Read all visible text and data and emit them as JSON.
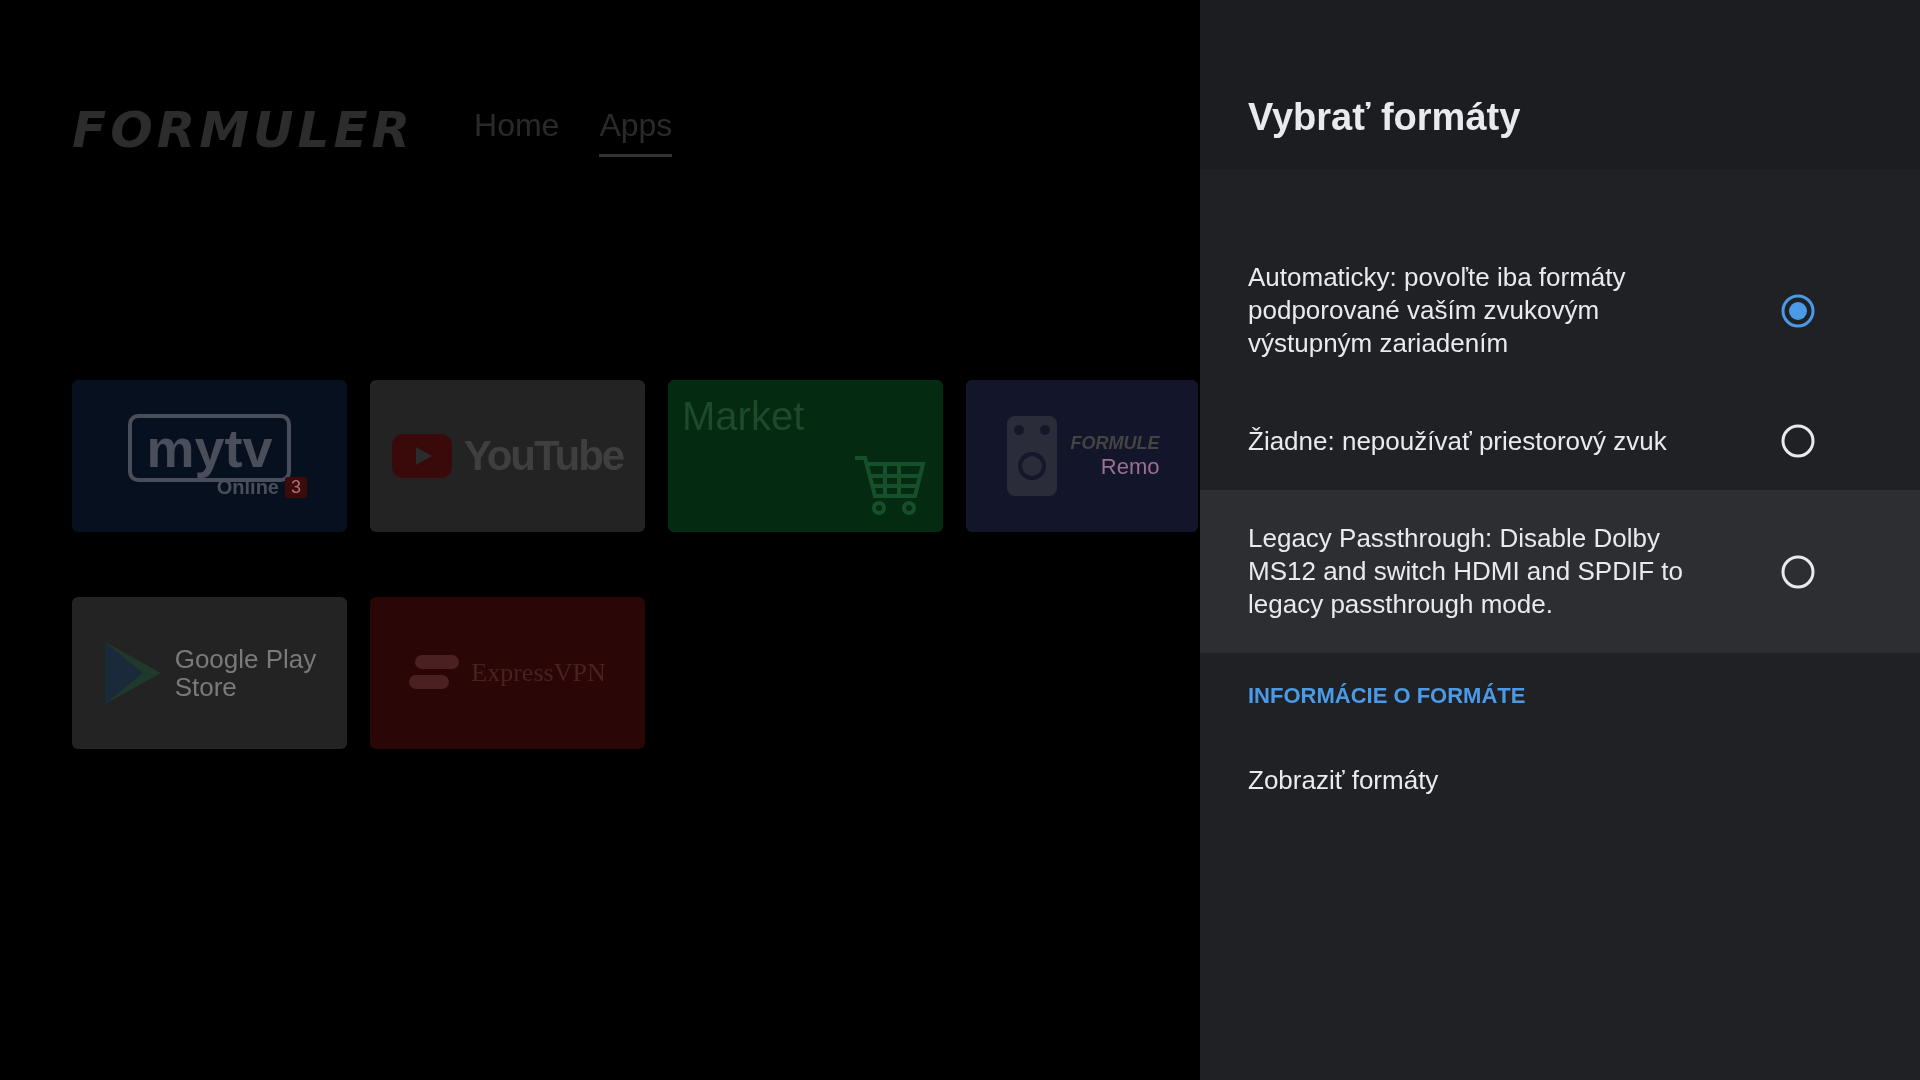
{
  "launcher": {
    "logo": "FORMULER",
    "nav": [
      {
        "label": "Home",
        "selected": false
      },
      {
        "label": "Apps",
        "selected": true
      }
    ],
    "tiles": [
      {
        "kind": "mytv",
        "texts": [
          "mytv",
          "Online",
          "3"
        ]
      },
      {
        "kind": "youtube",
        "texts": [
          "YouTube"
        ]
      },
      {
        "kind": "market",
        "texts": [
          "Market"
        ]
      },
      {
        "kind": "remote",
        "texts": [
          "FORMULE",
          "Remo"
        ]
      },
      {
        "kind": "play",
        "texts": [
          "Google Play",
          "Store"
        ]
      },
      {
        "kind": "vpn",
        "texts": [
          "ExpressVPN"
        ]
      }
    ]
  },
  "panel": {
    "title": "Vybrať formáty",
    "options": [
      {
        "label": "Automaticky: povoľte iba formáty podporované vaším zvukovým výstupným zariadením",
        "selected": true,
        "focused": false
      },
      {
        "label": "Žiadne: nepoužívať priestorový zvuk",
        "selected": false,
        "focused": false
      },
      {
        "label": "Legacy Passthrough: Disable Dolby MS12 and switch HDMI and SPDIF to legacy passthrough mode.",
        "selected": false,
        "focused": true
      }
    ],
    "section_header": "INFORMÁCIE O FORMÁTE",
    "items": [
      "Zobraziť formáty"
    ]
  }
}
